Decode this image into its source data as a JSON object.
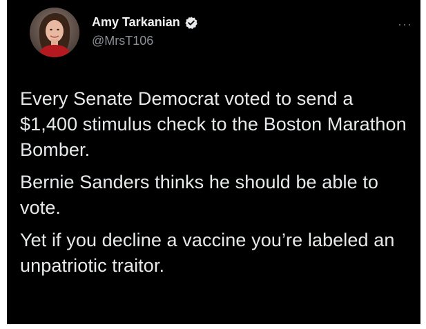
{
  "tweet": {
    "author": {
      "display_name": "Amy Tarkanian",
      "handle": "@MrsT106",
      "verified": true
    },
    "more_menu": "···",
    "paragraphs": [
      "Every Senate Democrat voted to send a $1,400 stimulus check to the Boston Marathon Bomber.",
      "Bernie Sanders thinks he should be able to vote.",
      "Yet if you decline a vaccine you’re labeled an unpatriotic traitor."
    ]
  },
  "icons": {
    "verified": "verified-badge-icon",
    "more": "more-options-icon",
    "avatar": "profile-photo"
  },
  "colors": {
    "card_background": "#000000",
    "page_background": "#ffffff",
    "text_primary": "#e7e9ea",
    "text_secondary": "#8b9096",
    "verified_badge": "#e7e9ea"
  }
}
